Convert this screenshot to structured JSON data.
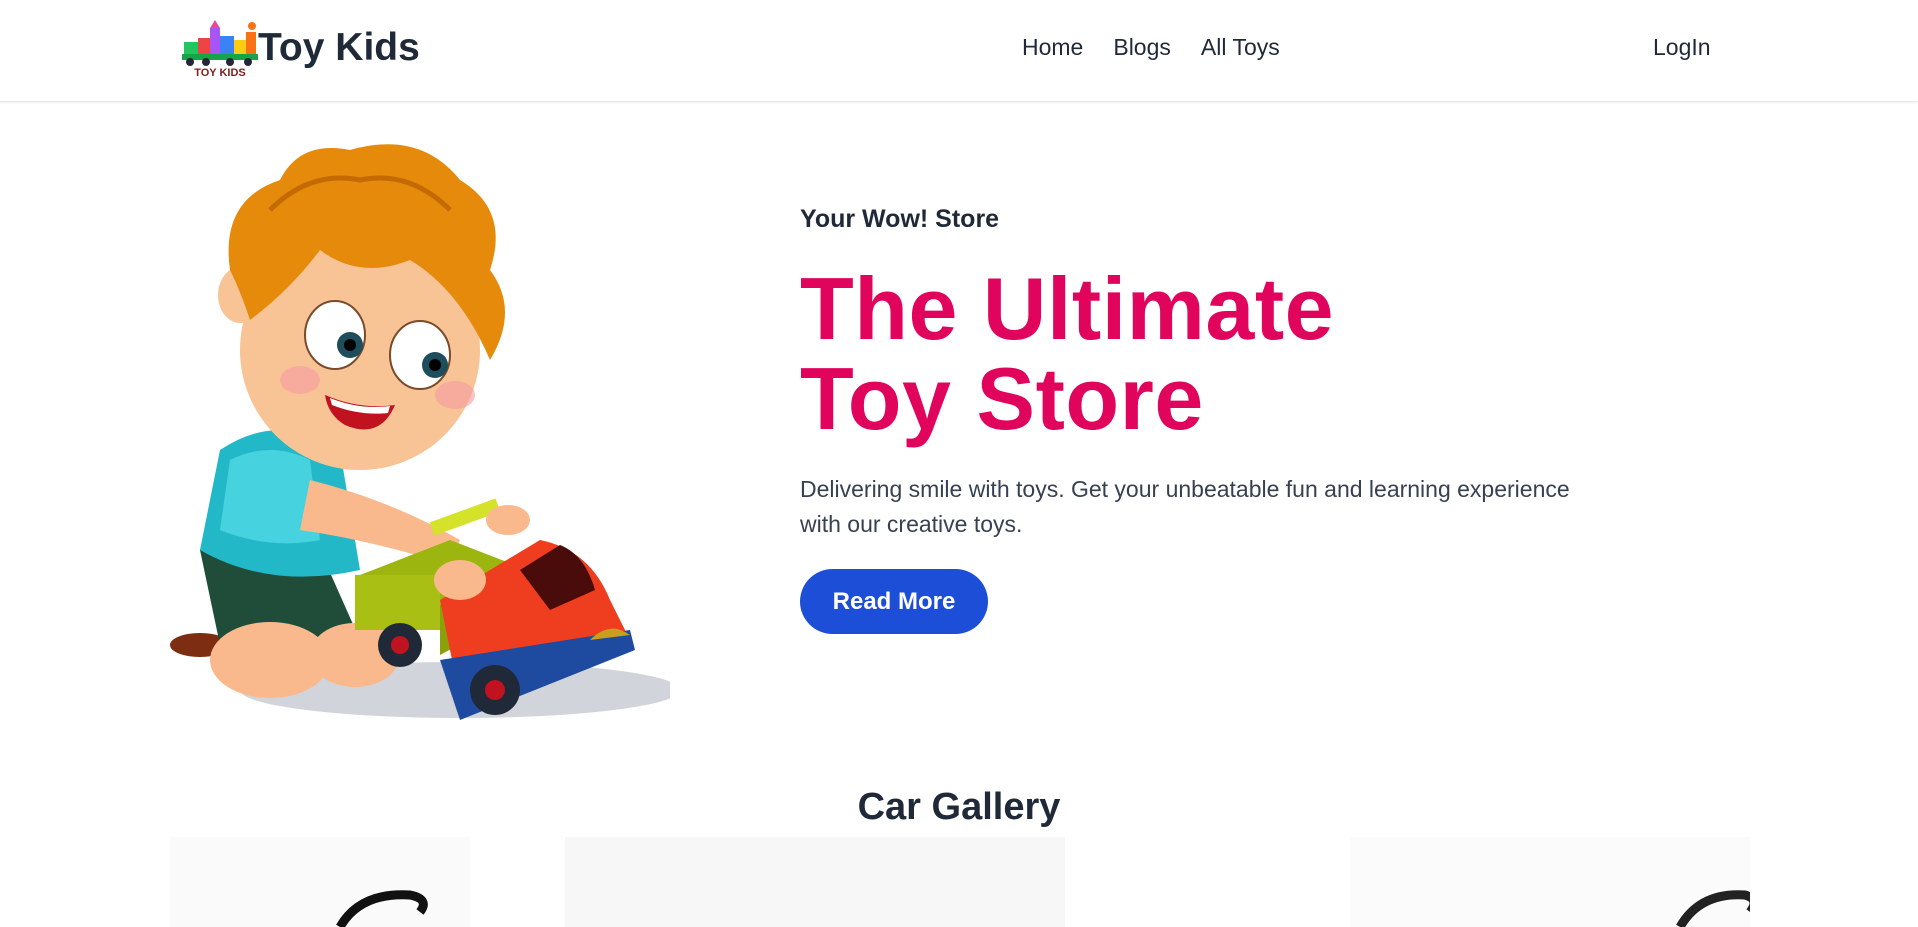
{
  "brand": {
    "name": "Toy Kids",
    "logo_text": "TOY KIDS"
  },
  "nav": {
    "links": [
      "Home",
      "Blogs",
      "All Toys"
    ],
    "login": "LogIn"
  },
  "hero": {
    "eyebrow": "Your Wow! Store",
    "headline": "The Ultimate Toy Store",
    "description": "Delivering smile with toys. Get your unbeatable fun and learning experience with our creative toys.",
    "cta": "Read More"
  },
  "gallery": {
    "title": "Car Gallery"
  },
  "colors": {
    "accent": "#e0045d",
    "button": "#1d4ed8",
    "text": "#1f2937"
  }
}
